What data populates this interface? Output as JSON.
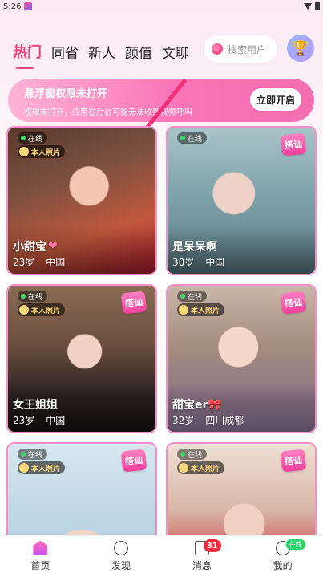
{
  "status_bar": {
    "time": "5:26"
  },
  "tabs": [
    {
      "label": "热门",
      "active": true
    },
    {
      "label": "同省",
      "active": false
    },
    {
      "label": "新人",
      "active": false
    },
    {
      "label": "颜值",
      "active": false
    },
    {
      "label": "文聊",
      "active": false
    }
  ],
  "search": {
    "placeholder": "搜索用户"
  },
  "banner": {
    "title": "悬浮窗权限未打开",
    "subtitle": "权限未打开，应用在后台可能无法收到视频呼叫",
    "button_label": "立即开启"
  },
  "card_labels": {
    "online": "在线",
    "verified": "本人照片",
    "chat": "搭讪"
  },
  "cards": [
    {
      "name": "小甜宝",
      "age": "23岁",
      "location": "中国",
      "name_icon": "heart-icon",
      "has_chat": false
    },
    {
      "name": "是呆呆啊",
      "age": "30岁",
      "location": "中国",
      "has_chat": true
    },
    {
      "name": "女王姐姐",
      "age": "23岁",
      "location": "中国",
      "has_chat": true
    },
    {
      "name": "甜宝er🎀",
      "age": "32岁",
      "location": "四川成都",
      "has_chat": true
    },
    {
      "name": "",
      "age": "",
      "location": "",
      "has_chat": true
    },
    {
      "name": "",
      "age": "",
      "location": "",
      "has_chat": true
    }
  ],
  "bottom_nav": [
    {
      "label": "首页",
      "icon": "home-icon",
      "active": true
    },
    {
      "label": "发现",
      "icon": "discover-icon"
    },
    {
      "label": "消息",
      "icon": "message-icon",
      "badge": "31"
    },
    {
      "label": "我的",
      "icon": "mine-icon",
      "badge": "在线"
    }
  ],
  "colors": {
    "accent": "#f23f7e",
    "card_border": "#f58fc7",
    "online": "#3ddc6a"
  }
}
